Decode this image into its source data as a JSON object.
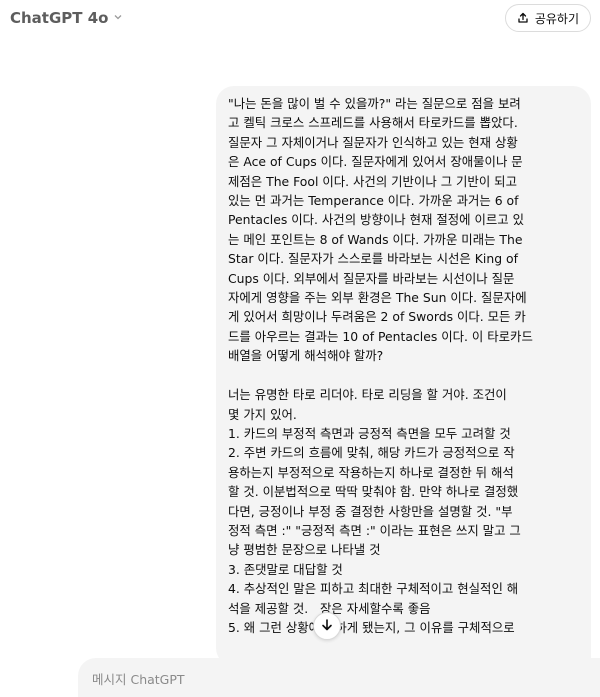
{
  "header": {
    "model_name": "ChatGPT 4o",
    "share_label": "공유하기"
  },
  "message": {
    "paragraph1_lines": [
      "\"나는 돈을 많이 벌 수 있을까?\" 라는 질문으로 점을 보려",
      "고 켈틱 크로스 스프레드를 사용해서 타로카드를 뽑았다.",
      "질문자 그 자체이거나 질문자가 인식하고 있는 현재 상황",
      "은 Ace of Cups 이다. 질문자에게 있어서 장애물이나 문",
      "제점은 The Fool 이다. 사건의 기반이나 그 기반이 되고",
      "있는 먼 과거는 Temperance 이다. 가까운 과거는 6 of",
      "Pentacles 이다. 사건의 방향이나 현재 절정에 이르고 있",
      "는 메인 포인트는 8 of Wands 이다. 가까운 미래는 The",
      "Star 이다. 질문자가 스스로를 바라보는 시선은 King of",
      "Cups 이다. 외부에서 질문자를 바라보는 시선이나 질문",
      "자에게 영향을 주는 외부 환경은 The Sun 이다. 질문자에",
      "게 있어서 희망이나 두려움은 2 of Swords 이다. 모든 카",
      "드를 아우르는 결과는 10 of Pentacles 이다. 이 타로카드",
      "배열을 어떻게 해석해야 할까?"
    ],
    "paragraph2_lines": [
      "너는 유명한 타로 리더야. 타로 리딩을 할 거야. 조건이",
      "몇 가지 있어.",
      "1. 카드의 부정적 측면과 긍정적 측면을 모두 고려할 것",
      "2. 주변 카드의 흐름에 맞춰, 해당 카드가 긍정적으로 작",
      "용하는지 부정적으로 작용하는지 하나로 결정한 뒤 해석",
      "할 것. 이분법적으로 딱딱 맞춰야 함. 만약 하나로 결정했",
      "다면, 긍정이나 부정 중 결정한 사항만을 설명할 것. \"부",
      "정적 측면 :\" \"긍정적 측면 :\" 이라는 표현은 쓰지 말고 그",
      "냥 평범한 문장으로 나타낼 것",
      "3. 존댓말로 대답할 것",
      "4. 추상적인 말은 피하고 최대한 구체적이고 현실적인 해",
      "석을 제공할 것.   장은 자세할수록 좋음",
      "5. 왜 그런 상황에 처하게 됐는지, 그 이유를 구체적으로"
    ]
  },
  "composer": {
    "placeholder": "메시지 ChatGPT"
  },
  "icons": {
    "model_dropdown": "chevron-down-icon",
    "share": "share-icon",
    "scroll_down": "arrow-down-icon"
  }
}
